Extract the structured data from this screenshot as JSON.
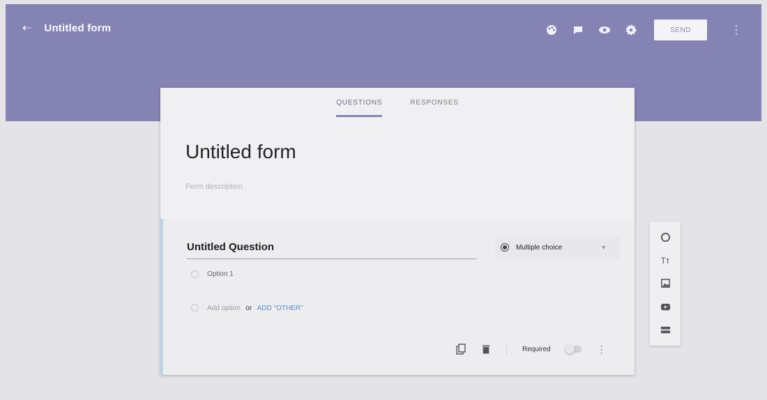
{
  "header": {
    "back_icon": "arrow-back-icon",
    "title": "Untitled form",
    "icons": [
      "palette-icon",
      "comment-icon",
      "preview-eye-icon",
      "settings-gear-icon"
    ],
    "send_label": "SEND",
    "more_icon": "more-vert-icon",
    "color": "#8583b4"
  },
  "tabs": [
    {
      "label": "QUESTIONS",
      "active": true
    },
    {
      "label": "RESPONSES",
      "active": false
    }
  ],
  "form": {
    "title": "Untitled form",
    "description_placeholder": "Form description"
  },
  "question": {
    "title": "Untitled Question",
    "type_label": "Multiple choice",
    "option1": "Option 1",
    "add_option": "Add option",
    "or": "or",
    "add_other": "ADD \"OTHER\"",
    "required_label": "Required"
  },
  "toolbar": {
    "icons": [
      "add-question-icon",
      "add-title-icon",
      "add-image-icon",
      "add-video-icon",
      "add-section-icon"
    ],
    "title_glyph": "Tт"
  }
}
